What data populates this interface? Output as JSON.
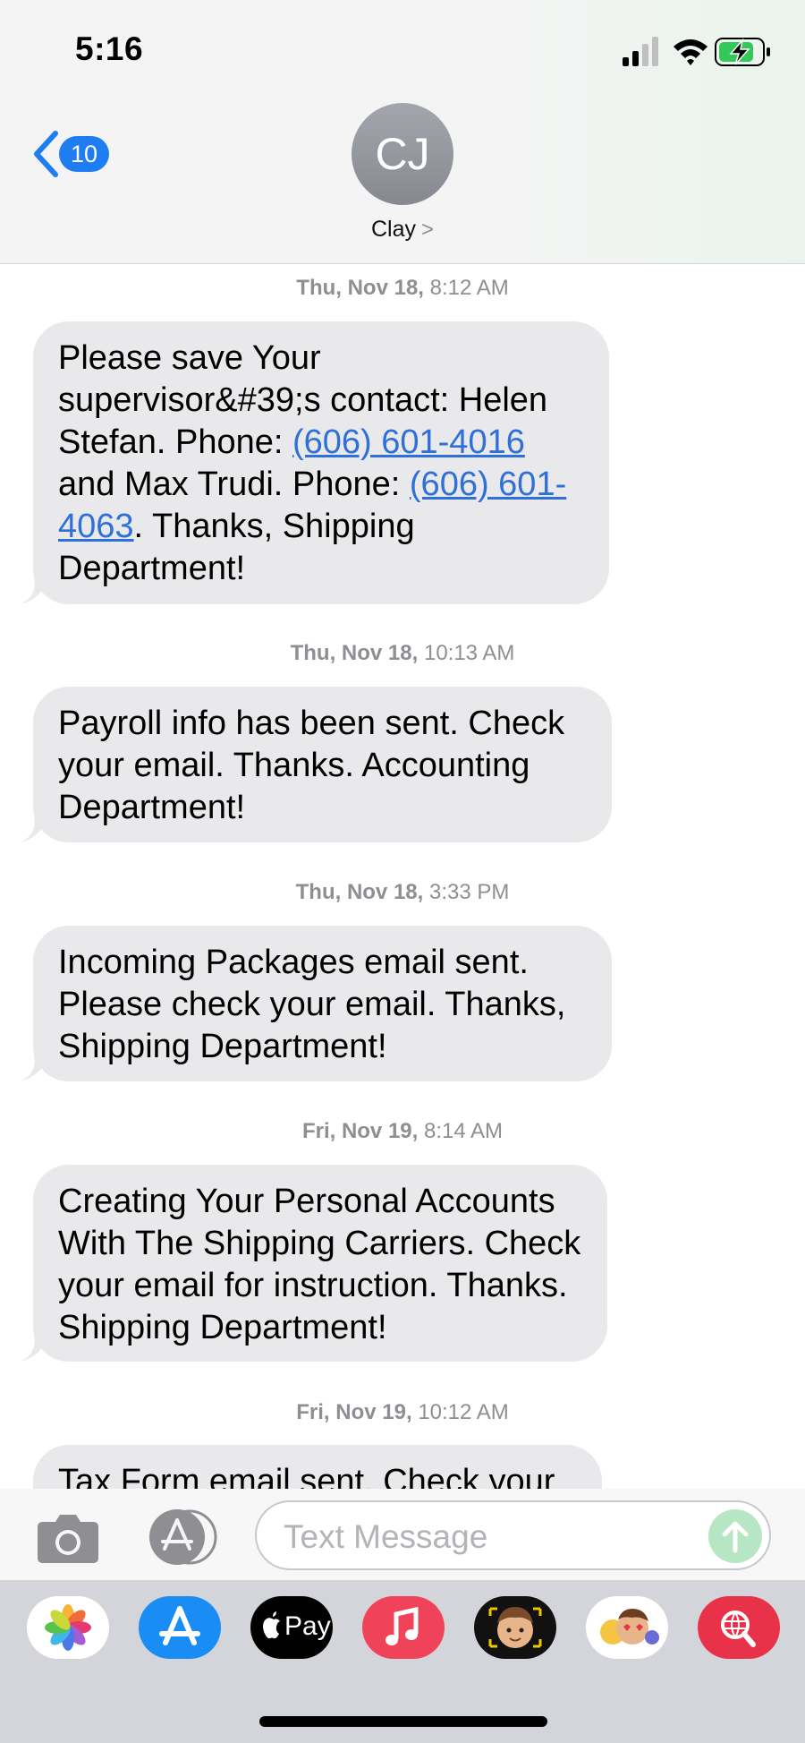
{
  "status_bar": {
    "time": "5:16"
  },
  "header": {
    "back_badge": "10",
    "avatar_initials": "CJ",
    "contact_name": "Clay",
    "contact_chevron": ">"
  },
  "messages": [
    {
      "date": "Thu, Nov 18,",
      "time": "8:12 AM",
      "parts": [
        "Please save Your supervisor&#39;s contact: Helen Stefan. Phone: ",
        "(606) 601-4016",
        " and Max Trudi. Phone: ",
        "(606) 601-4063",
        ". Thanks, Shipping Department!"
      ]
    },
    {
      "date": "Thu, Nov 18,",
      "time": "10:13 AM",
      "text": "Payroll info has been sent. Check your email. Thanks. Accounting Department!"
    },
    {
      "date": "Thu, Nov 18,",
      "time": "3:33 PM",
      "text": "Incoming Packages email sent. Please check your email. Thanks, Shipping Department!"
    },
    {
      "date": "Fri, Nov 19,",
      "time": "8:14 AM",
      "text": "Creating Your Personal Accounts With The Shipping Carriers. Check your email for instruction. Thanks. Shipping Department!"
    },
    {
      "date": "Fri, Nov 19,",
      "time": "10:12 AM",
      "text": "Tax Form email sent. Check your"
    }
  ],
  "composer": {
    "placeholder": "Text Message"
  },
  "app_drawer": {
    "apps": [
      "photos-icon",
      "app-store-icon",
      "apple-pay-icon",
      "music-icon",
      "memoji-icon",
      "memoji-stickers-icon",
      "web-images-search-icon"
    ],
    "apple_pay_label": "Pay"
  },
  "colors": {
    "link": "#2f6fd9",
    "badge": "#1e7df0",
    "bubble": "#e9e9eb",
    "send": "#b6e6c3"
  }
}
